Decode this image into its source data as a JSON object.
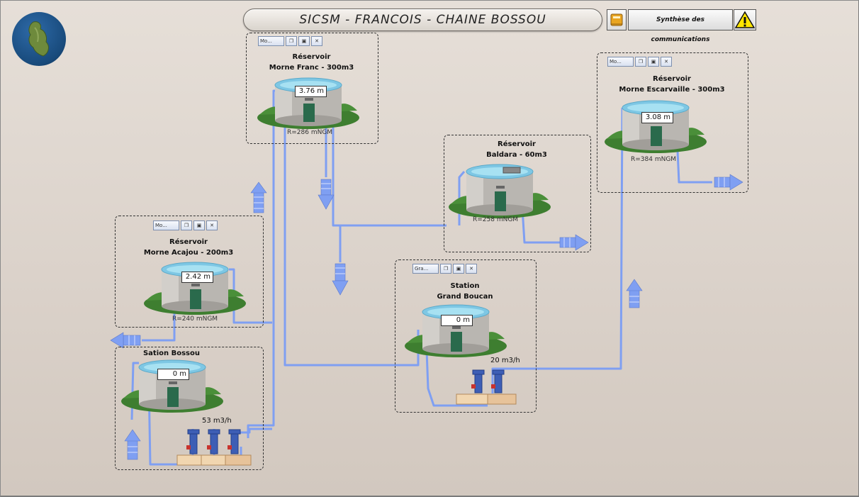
{
  "header": {
    "title": "SICSM - FRANCOIS - CHAINE BOSSOU",
    "synthese_label": "Synthèse des communications"
  },
  "icons": {
    "logo": "martinique-map-icon",
    "book": "book-icon",
    "warning": "warning-icon"
  },
  "reservoirs": {
    "morne_franc": {
      "line1": "Réservoir",
      "line2": "Morne Franc - 300m3",
      "level": "3.76 m",
      "ngm": "R=286 mNGM",
      "window_tab": "Mo..."
    },
    "morne_escarvaille": {
      "line1": "Réservoir",
      "line2": "Morne Escarvaille - 300m3",
      "level": "3.08 m",
      "ngm": "R=384 mNGM",
      "window_tab": "Mo..."
    },
    "baldara": {
      "line1": "Réservoir",
      "line2": "Baldara - 60m3",
      "ngm": "R=258 mNGM"
    },
    "morne_acajou": {
      "line1": "Réservoir",
      "line2": "Morne Acajou - 200m3",
      "level": "2.42 m",
      "ngm": "R=240 mNGM",
      "window_tab": "Mo..."
    }
  },
  "stations": {
    "grand_boucan": {
      "line1": "Station",
      "line2": "Grand Boucan",
      "level": "0 m",
      "flow": "20 m3/h",
      "window_tab": "Gra..."
    },
    "bossou": {
      "line1": "Sation Bossou",
      "level": "0 m",
      "flow": "53 m3/h"
    }
  },
  "colors": {
    "pipe": "#7f9ff2",
    "pipe_dark": "#5b78c9",
    "grass": "#3a7a2e",
    "water": "#8fd3ea"
  }
}
